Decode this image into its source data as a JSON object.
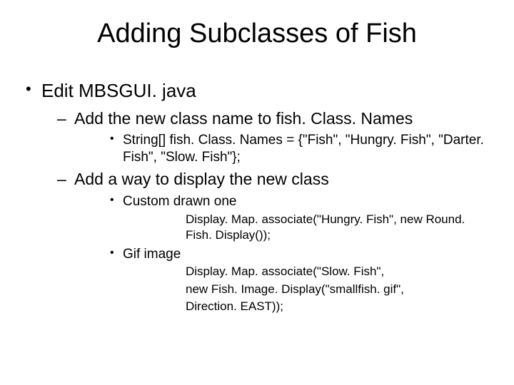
{
  "title": "Adding Subclasses of Fish",
  "b1": "Edit MBSGUI. java",
  "b1_1": "Add the new class name to fish. Class. Names",
  "b1_1_code": "String[] fish. Class. Names = {\"Fish\", \"Hungry. Fish\", \"Darter. Fish\", \"Slow. Fish\"};",
  "b1_2": "Add a way to display the new class",
  "b1_2_a": "Custom drawn one",
  "b1_2_a_code": "Display. Map. associate(\"Hungry. Fish\", new Round. Fish. Display());",
  "b1_2_b": "Gif image",
  "b1_2_b_code1": "Display. Map. associate(\"Slow. Fish\",",
  "b1_2_b_code2": " new Fish. Image. Display(\"smallfish. gif\",",
  "b1_2_b_code3": "Direction. EAST));"
}
